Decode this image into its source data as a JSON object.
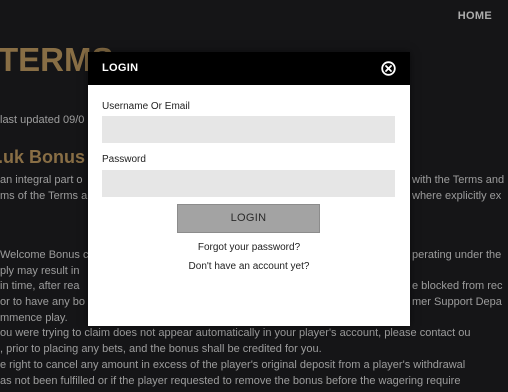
{
  "nav": {
    "home_label": "HOME"
  },
  "page": {
    "title": "TERMS",
    "last_updated": "last updated 09/0",
    "section_heading": ".uk Bonus P",
    "lines": [
      "an integral part o",
      "ms of the Terms a",
      "Welcome Bonus c",
      "ply may result in",
      "in time, after rea",
      "or to have any bo",
      "mmence play.",
      "ou were trying to claim does not appear automatically in your player's account, please contact ou",
      ", prior to placing any bets, and the bonus shall be credited for you.",
      "e right to cancel any amount in excess of the player's original deposit from a player's withdrawal",
      "as not been fulfilled or if the player requested to remove the bonus before the wagering require"
    ],
    "right_fragments": [
      "with the Terms and",
      "where explicitly ex",
      "perating under the",
      "e blocked from rec",
      "mer Support Depa"
    ]
  },
  "modal": {
    "title": "LOGIN",
    "username_label": "Username Or Email",
    "username_value": "",
    "password_label": "Password",
    "password_value": "",
    "login_button": "LOGIN",
    "forgot_link": "Forgot your password?",
    "signup_link": "Don't have an account yet?"
  },
  "icons": {
    "close": "close-circle-icon"
  },
  "colors": {
    "background": "#1c1c1f",
    "accent_gold": "#b6935c",
    "modal_header": "#000000",
    "input_bg": "#e6e6e6",
    "button_bg": "#a3a3a3"
  }
}
